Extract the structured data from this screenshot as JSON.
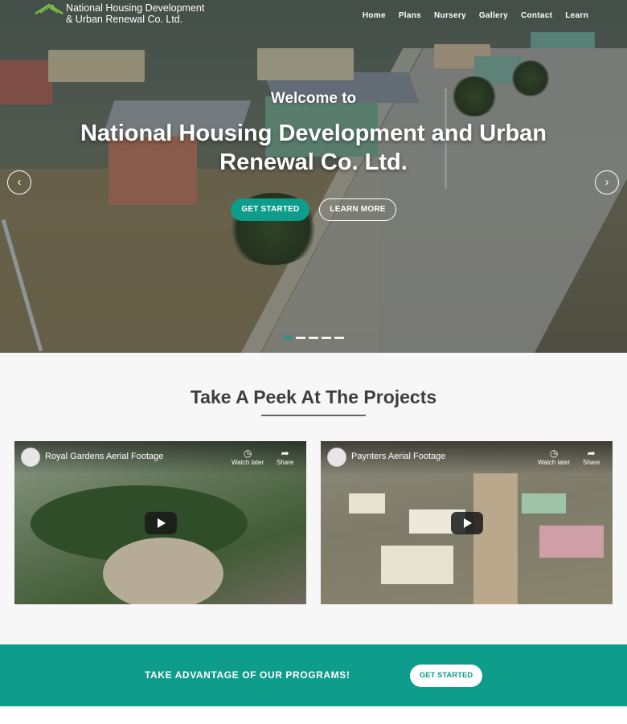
{
  "brand": {
    "line1": "National Housing Development",
    "line2": "& Urban Renewal Co. Ltd.",
    "icon": "house-roof-logo-icon"
  },
  "nav": {
    "items": [
      {
        "label": "Home"
      },
      {
        "label": "Plans"
      },
      {
        "label": "Nursery"
      },
      {
        "label": "Gallery"
      },
      {
        "label": "Contact"
      },
      {
        "label": "Learn"
      }
    ]
  },
  "hero": {
    "welcome": "Welcome to",
    "title": "National Housing Development and Urban Renewal Co. Ltd.",
    "primary_button": "GET STARTED",
    "secondary_button": "LEARN MORE",
    "prev_icon": "chevron-left-icon",
    "next_icon": "chevron-right-icon",
    "slide_count": 5,
    "active_slide": 1
  },
  "projects": {
    "heading": "Take A Peek At The Projects",
    "videos": [
      {
        "title": "Royal Gardens Aerial Footage",
        "watch_later": "Watch later",
        "share": "Share"
      },
      {
        "title": "Paynters Aerial Footage",
        "watch_later": "Watch later",
        "share": "Share"
      }
    ]
  },
  "cta": {
    "text": "TAKE ADVANTAGE OF OUR PROGRAMS!",
    "button": "GET STARTED"
  },
  "colors": {
    "accent": "#0e9c8b",
    "heading": "#3d3d3d"
  }
}
